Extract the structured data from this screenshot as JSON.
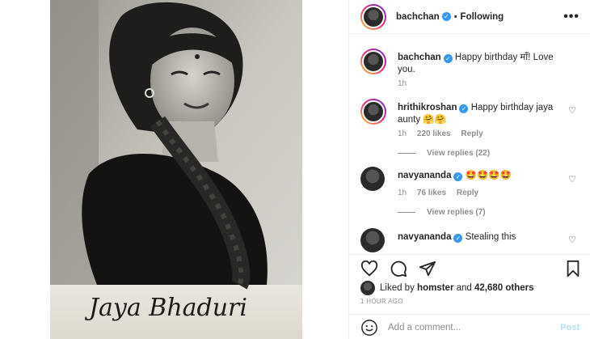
{
  "header": {
    "username": "bachchan",
    "separator": "•",
    "follow_status": "Following",
    "more_icon": "•••"
  },
  "photo": {
    "signature": "Jaya Bhaduri"
  },
  "caption": {
    "username": "bachchan",
    "text": "Happy birthday माँ! Love you.",
    "time": "1h"
  },
  "comments": [
    {
      "username": "hrithikroshan",
      "text": "Happy birthday jaya aunty 🤗🤗",
      "time": "1h",
      "likes": "220 likes",
      "reply": "Reply",
      "view_replies": "View replies (22)"
    },
    {
      "username": "navyananda",
      "text": "🤩🤩🤩🤩",
      "time": "1h",
      "likes": "76 likes",
      "reply": "Reply",
      "view_replies": "View replies (7)"
    },
    {
      "username": "navyananda",
      "text": "Stealing this"
    }
  ],
  "likes": {
    "prefix": "Liked by",
    "user": "homster",
    "and": "and",
    "others": "42,680 others"
  },
  "timestamp": "1 HOUR AGO",
  "comment_box": {
    "placeholder": "Add a comment...",
    "post_label": "Post"
  },
  "colors": {
    "verified": "#3897f0",
    "post_disabled": "#b2dffc",
    "muted_text": "#8e8e8e"
  }
}
